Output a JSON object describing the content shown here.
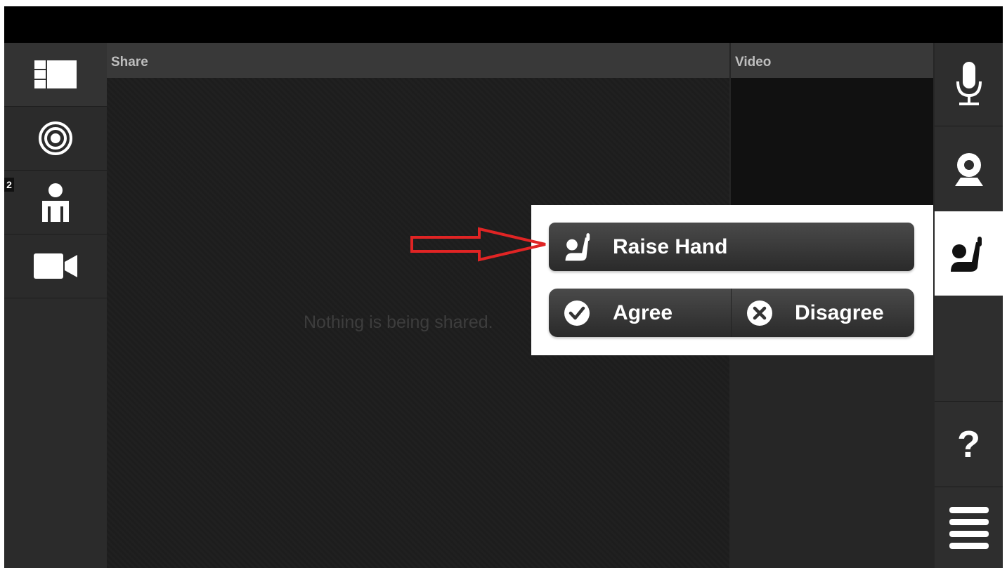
{
  "colors": {
    "background": "#262626",
    "topbar": "#000000",
    "header": "#393939",
    "popover": "#ffffff",
    "button": "#3a3a3a",
    "annotation_arrow": "#e02424"
  },
  "left_sidebar": {
    "items": [
      {
        "icon": "layout-icon"
      },
      {
        "icon": "broadcast-icon"
      },
      {
        "icon": "participants-icon",
        "badge": "2"
      },
      {
        "icon": "video-camera-icon"
      }
    ]
  },
  "share": {
    "header": "Share",
    "empty_text": "Nothing is being shared."
  },
  "video": {
    "header": "Video"
  },
  "feedback_popover": {
    "raise_hand_label": "Raise Hand",
    "agree_label": "Agree",
    "disagree_label": "Disagree"
  },
  "right_sidebar": {
    "items": [
      {
        "icon": "microphone-icon"
      },
      {
        "icon": "webcam-icon"
      },
      {
        "icon": "raise-hand-icon"
      },
      {
        "icon": "help-icon",
        "glyph": "?"
      },
      {
        "icon": "menu-icon"
      }
    ]
  }
}
